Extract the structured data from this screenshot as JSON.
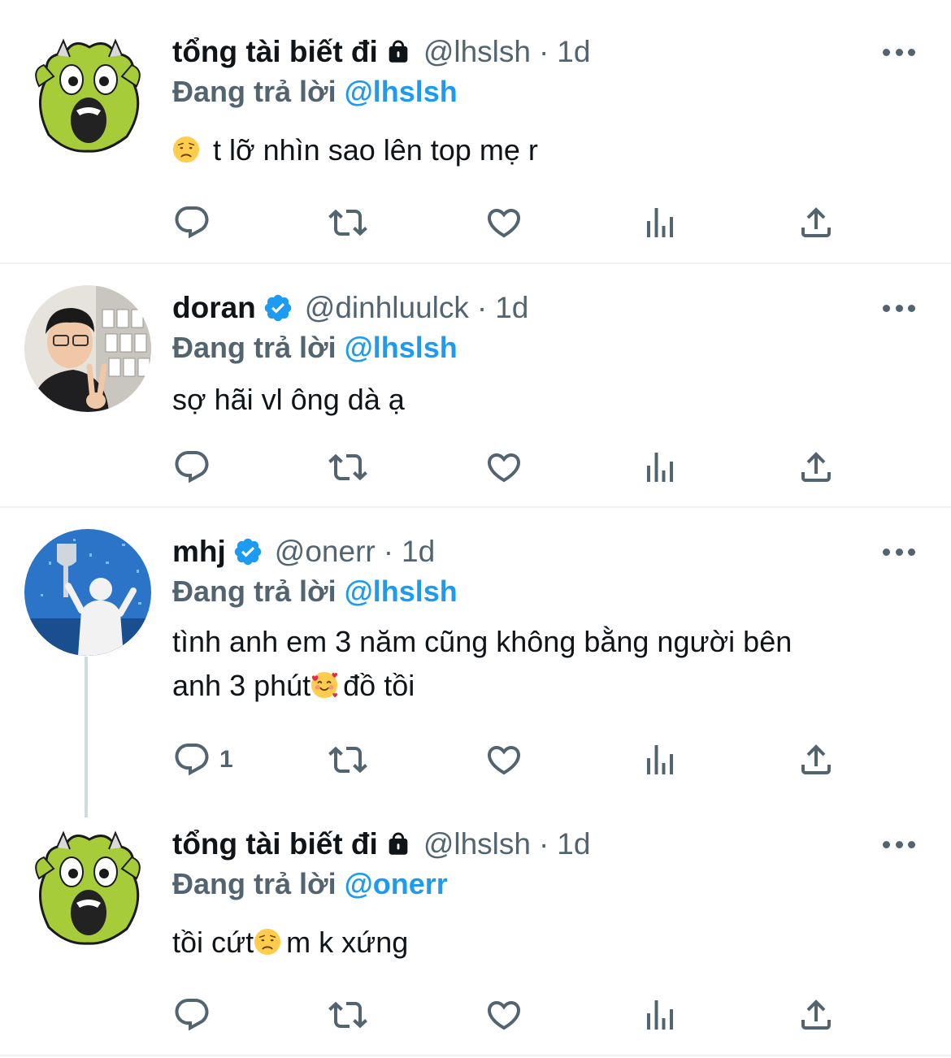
{
  "tweets": [
    {
      "name": "tổng tài biết đi",
      "badge": "lock",
      "handle": "@lhslsh",
      "dot": "·",
      "time": "1d",
      "replying_prefix": "Đang trả lời",
      "replying_to": "@lhslsh",
      "text_parts": [
        "",
        "t lỡ nhìn sao lên top mẹ r"
      ],
      "emoji": [
        "disappointed-face"
      ],
      "reply_count": "",
      "avatar": "green-monster"
    },
    {
      "name": "doran",
      "badge": "verified",
      "handle": "@dinhluulck",
      "dot": "·",
      "time": "1d",
      "replying_prefix": "Đang trả lời",
      "replying_to": "@lhslsh",
      "text": "sợ hãi vl ông dà ạ",
      "reply_count": "",
      "avatar": "person-peace-sign"
    },
    {
      "name": "mhj",
      "badge": "verified",
      "handle": "@onerr",
      "dot": "·",
      "time": "1d",
      "replying_prefix": "Đang trả lời",
      "replying_to": "@lhslsh",
      "text_line1": "tình anh em 3 năm cũng không bằng người bên",
      "text_line2_a": "anh 3 phút",
      "text_line2_b": "đồ tồi",
      "emoji": [
        "smiling-face-with-hearts"
      ],
      "reply_count": "1",
      "avatar": "trophy-stage"
    },
    {
      "name": "tổng tài biết đi",
      "badge": "lock",
      "handle": "@lhslsh",
      "dot": "·",
      "time": "1d",
      "replying_prefix": "Đang trả lời",
      "replying_to": "@onerr",
      "text_a": "tồi cứt",
      "text_b": "m k xứng",
      "emoji": [
        "disappointed-face"
      ],
      "reply_count": "",
      "avatar": "green-monster"
    }
  ],
  "icons": [
    "reply-icon",
    "retweet-icon",
    "like-icon",
    "views-icon",
    "share-icon",
    "more-icon"
  ],
  "colors": {
    "accent": "#1d9bf0",
    "muted": "#536471",
    "text": "#0f1419",
    "divider": "#eff3f4"
  }
}
